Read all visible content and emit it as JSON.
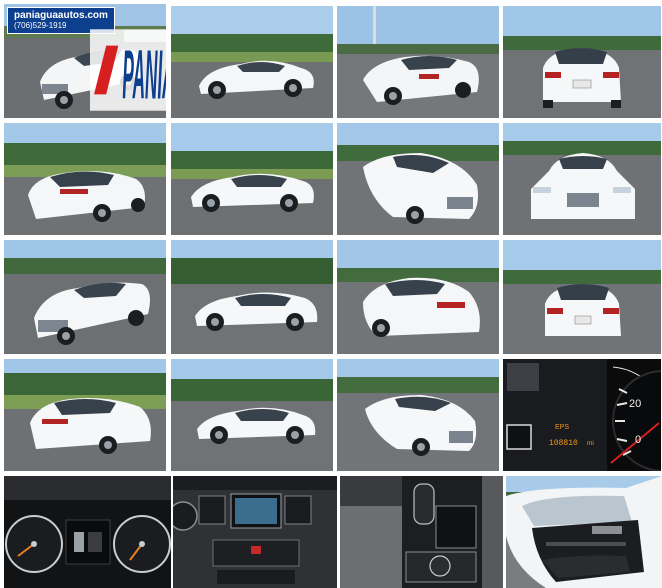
{
  "watermark": {
    "site": "paniaguaautos.com",
    "phone": "(706)529-1919",
    "brand": "PANIAGUA",
    "brand_color": "#0d3f8f",
    "accent_color": "#d62020"
  },
  "photos": [
    {
      "name": "photo-front-left-1"
    },
    {
      "name": "photo-side-left-1"
    },
    {
      "name": "photo-rear-left-1"
    },
    {
      "name": "photo-rear-1"
    },
    {
      "name": "photo-rear-left-2"
    },
    {
      "name": "photo-side-left-2"
    },
    {
      "name": "photo-front-right-1"
    },
    {
      "name": "photo-front-1"
    },
    {
      "name": "photo-front-left-2"
    },
    {
      "name": "photo-side-left-3"
    },
    {
      "name": "photo-rear-right-1"
    },
    {
      "name": "photo-rear-2"
    },
    {
      "name": "photo-rear-left-3"
    },
    {
      "name": "photo-side-left-4"
    },
    {
      "name": "photo-front-right-2"
    },
    {
      "name": "photo-odometer"
    },
    {
      "name": "photo-gauge-cluster"
    },
    {
      "name": "photo-center-console"
    },
    {
      "name": "photo-gear-shifter"
    },
    {
      "name": "photo-door-panel"
    }
  ],
  "odometer": {
    "speed_value": "20",
    "zero_value": "0",
    "mileage": "108810",
    "unit": "mi",
    "mode": "EPS"
  }
}
